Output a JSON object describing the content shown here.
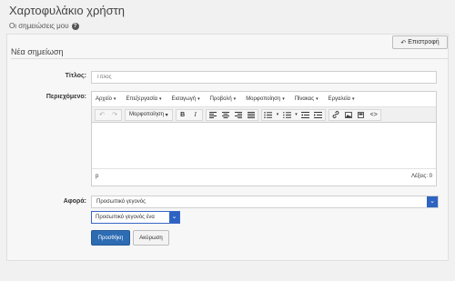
{
  "header": {
    "title": "Χαρτοφυλάκιο χρήστη",
    "subtitle": "Οι σημειώσεις μου"
  },
  "toolbar": {
    "back_label": "Επιστροφή"
  },
  "form": {
    "section_title": "Νέα σημείωση",
    "title_label": "Τίτλος:",
    "title_placeholder": "Τίτλος",
    "content_label": "Περιεχόμενο:",
    "about_label": "Αφορά:",
    "about_value": "Προσωπικό γεγονός",
    "about_sub_value": "Προσωπικό γεγονός ένα",
    "submit_label": "Προσθήκη",
    "cancel_label": "Ακύρωση"
  },
  "editor": {
    "menu": [
      "Αρχείο",
      "Επεξεργασία",
      "Εισαγωγή",
      "Προβολή",
      "Μορφοποίηση",
      "Πίνακας",
      "Εργαλεία"
    ],
    "format_label": "Μορφοποίηση",
    "status_path": "p",
    "word_count": "Λέξεις: 0"
  },
  "icons": {
    "back": "arrow-back-icon",
    "help": "question-circle-icon"
  },
  "colors": {
    "primary": "#2d6cb3",
    "select_arrow": "#2e63c2"
  }
}
